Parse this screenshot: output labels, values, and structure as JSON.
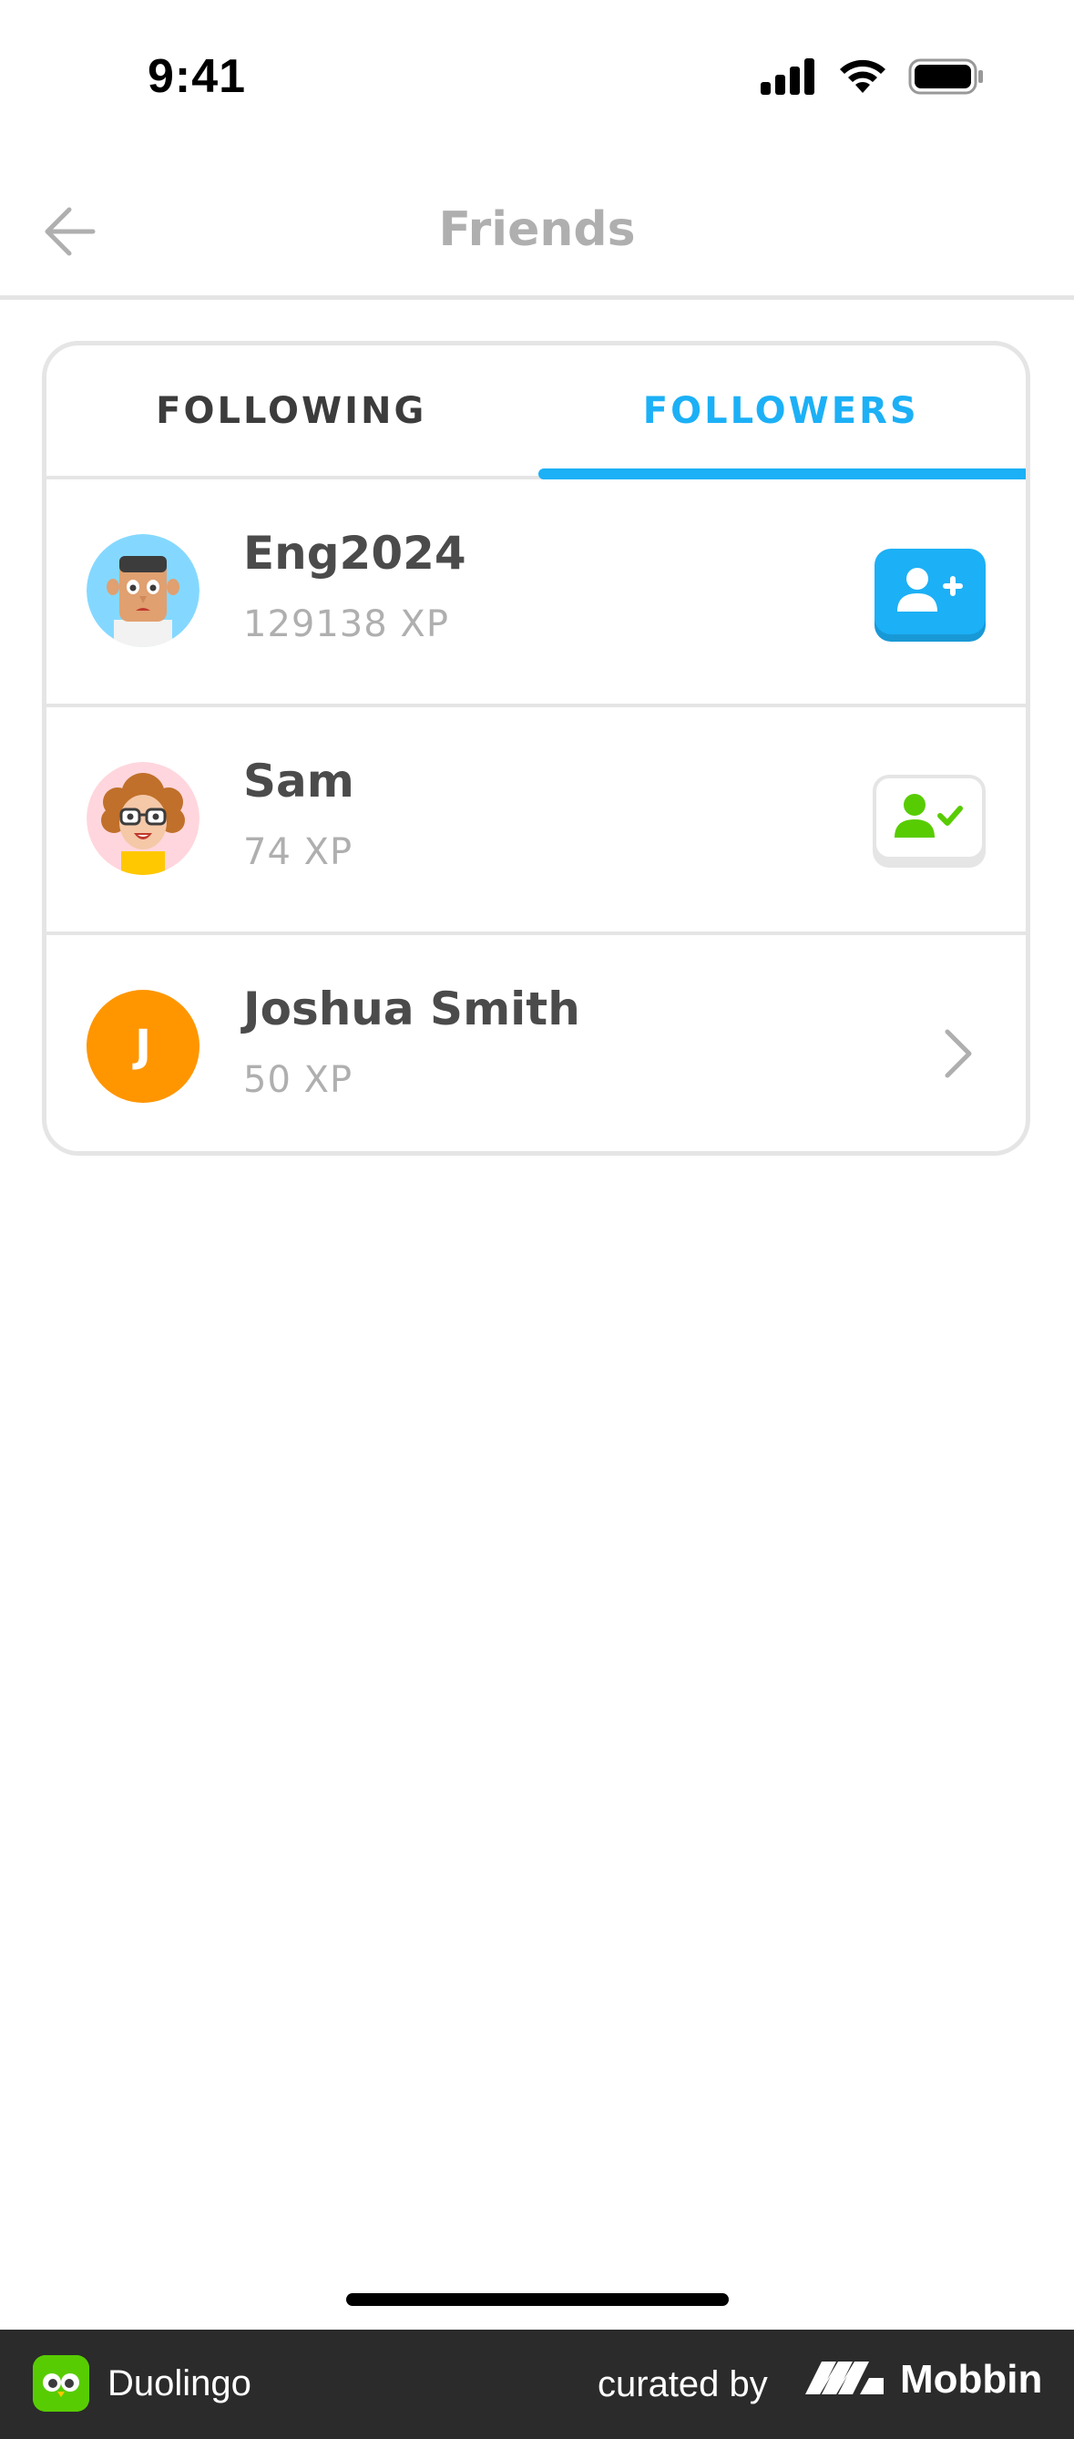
{
  "status_bar": {
    "time": "9:41"
  },
  "header": {
    "title": "Friends",
    "back_icon": "arrow-left-icon"
  },
  "tabs": [
    {
      "label": "FOLLOWING",
      "active": false
    },
    {
      "label": "FOLLOWERS",
      "active": true
    }
  ],
  "followers": [
    {
      "name": "Eng2024",
      "xp": "129138 XP",
      "avatar": "avatar-illustration-man",
      "action": "follow",
      "action_icon": "add-user-icon"
    },
    {
      "name": "Sam",
      "xp": "74 XP",
      "avatar": "avatar-illustration-woman-glasses",
      "action": "following",
      "action_icon": "user-check-icon"
    },
    {
      "name": "Joshua Smith",
      "xp": "50 XP",
      "avatar_initial": "J",
      "action": "view",
      "action_icon": "chevron-right-icon"
    }
  ],
  "colors": {
    "accent": "#1cb0f6",
    "text_primary": "#4b4b4b",
    "text_muted": "#afafaf",
    "border": "#e5e5e5",
    "initial_avatar": "#ff9600",
    "check_green": "#58cc02"
  },
  "footer": {
    "app_name": "Duolingo",
    "curated_by": "curated by",
    "brand": "Mobbin"
  }
}
